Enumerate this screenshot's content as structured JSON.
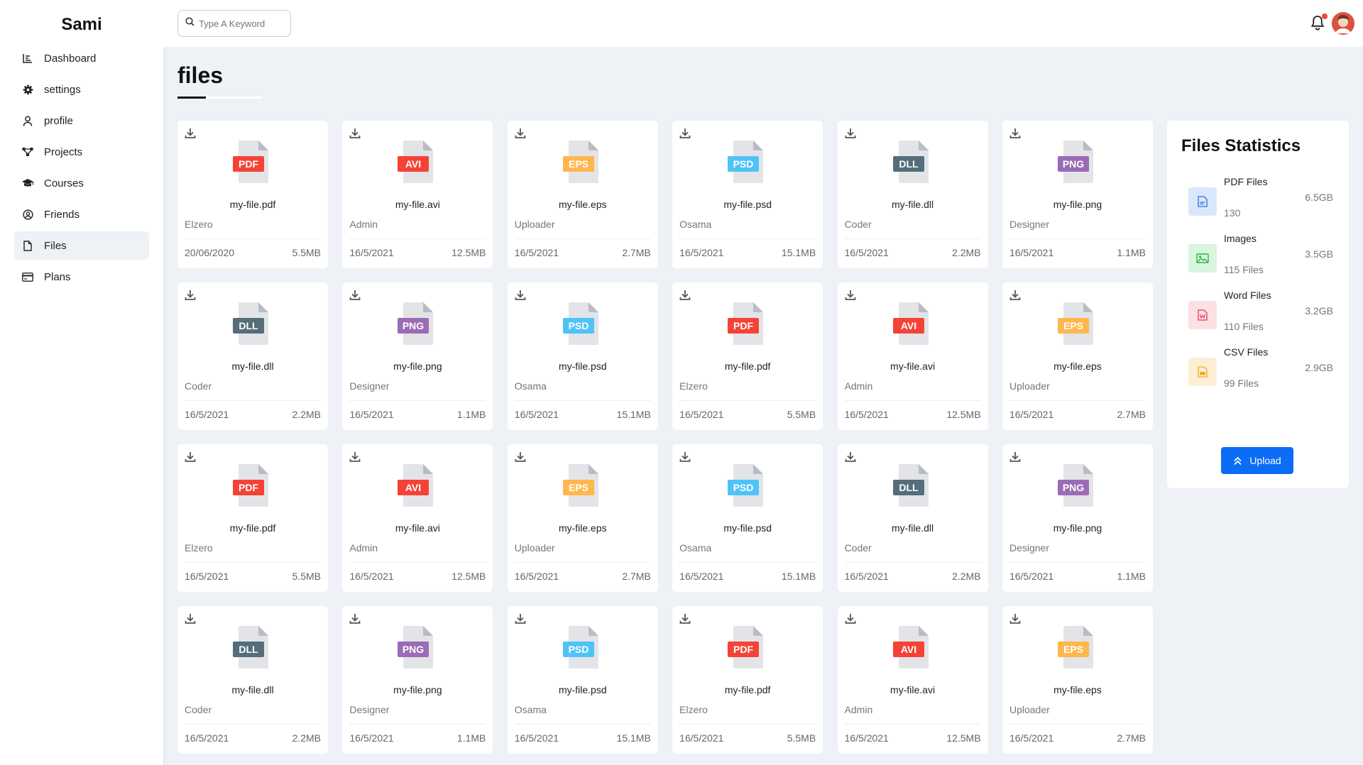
{
  "app": {
    "brand": "Sami"
  },
  "sidebar": {
    "items": [
      {
        "label": "Dashboard",
        "icon": "chart-icon"
      },
      {
        "label": "settings",
        "icon": "gear-icon"
      },
      {
        "label": "profile",
        "icon": "user-icon"
      },
      {
        "label": "Projects",
        "icon": "diagram-icon"
      },
      {
        "label": "Courses",
        "icon": "graduation-cap-icon"
      },
      {
        "label": "Friends",
        "icon": "user-circle-icon"
      },
      {
        "label": "Files",
        "icon": "file-icon",
        "active": true
      },
      {
        "label": "Plans",
        "icon": "credit-card-icon"
      }
    ]
  },
  "header": {
    "search_placeholder": "Type A Keyword"
  },
  "page": {
    "title": "files"
  },
  "type_colors": {
    "PDF": "#f44336",
    "AVI": "#f44336",
    "EPS": "#ffb74d",
    "PSD": "#4fc3f7",
    "DLL": "#546e7a",
    "PNG": "#9c6bb7"
  },
  "files": [
    {
      "type": "PDF",
      "name": "my-file.pdf",
      "owner": "Elzero",
      "date": "20/06/2020",
      "size": "5.5MB"
    },
    {
      "type": "AVI",
      "name": "my-file.avi",
      "owner": "Admin",
      "date": "16/5/2021",
      "size": "12.5MB"
    },
    {
      "type": "EPS",
      "name": "my-file.eps",
      "owner": "Uploader",
      "date": "16/5/2021",
      "size": "2.7MB"
    },
    {
      "type": "PSD",
      "name": "my-file.psd",
      "owner": "Osama",
      "date": "16/5/2021",
      "size": "15.1MB"
    },
    {
      "type": "DLL",
      "name": "my-file.dll",
      "owner": "Coder",
      "date": "16/5/2021",
      "size": "2.2MB"
    },
    {
      "type": "PNG",
      "name": "my-file.png",
      "owner": "Designer",
      "date": "16/5/2021",
      "size": "1.1MB"
    },
    {
      "type": "DLL",
      "name": "my-file.dll",
      "owner": "Coder",
      "date": "16/5/2021",
      "size": "2.2MB"
    },
    {
      "type": "PNG",
      "name": "my-file.png",
      "owner": "Designer",
      "date": "16/5/2021",
      "size": "1.1MB"
    },
    {
      "type": "PSD",
      "name": "my-file.psd",
      "owner": "Osama",
      "date": "16/5/2021",
      "size": "15.1MB"
    },
    {
      "type": "PDF",
      "name": "my-file.pdf",
      "owner": "Elzero",
      "date": "16/5/2021",
      "size": "5.5MB"
    },
    {
      "type": "AVI",
      "name": "my-file.avi",
      "owner": "Admin",
      "date": "16/5/2021",
      "size": "12.5MB"
    },
    {
      "type": "EPS",
      "name": "my-file.eps",
      "owner": "Uploader",
      "date": "16/5/2021",
      "size": "2.7MB"
    },
    {
      "type": "PDF",
      "name": "my-file.pdf",
      "owner": "Elzero",
      "date": "16/5/2021",
      "size": "5.5MB"
    },
    {
      "type": "AVI",
      "name": "my-file.avi",
      "owner": "Admin",
      "date": "16/5/2021",
      "size": "12.5MB"
    },
    {
      "type": "EPS",
      "name": "my-file.eps",
      "owner": "Uploader",
      "date": "16/5/2021",
      "size": "2.7MB"
    },
    {
      "type": "PSD",
      "name": "my-file.psd",
      "owner": "Osama",
      "date": "16/5/2021",
      "size": "15.1MB"
    },
    {
      "type": "DLL",
      "name": "my-file.dll",
      "owner": "Coder",
      "date": "16/5/2021",
      "size": "2.2MB"
    },
    {
      "type": "PNG",
      "name": "my-file.png",
      "owner": "Designer",
      "date": "16/5/2021",
      "size": "1.1MB"
    },
    {
      "type": "DLL",
      "name": "my-file.dll",
      "owner": "Coder",
      "date": "16/5/2021",
      "size": "2.2MB"
    },
    {
      "type": "PNG",
      "name": "my-file.png",
      "owner": "Designer",
      "date": "16/5/2021",
      "size": "1.1MB"
    },
    {
      "type": "PSD",
      "name": "my-file.psd",
      "owner": "Osama",
      "date": "16/5/2021",
      "size": "15.1MB"
    },
    {
      "type": "PDF",
      "name": "my-file.pdf",
      "owner": "Elzero",
      "date": "16/5/2021",
      "size": "5.5MB"
    },
    {
      "type": "AVI",
      "name": "my-file.avi",
      "owner": "Admin",
      "date": "16/5/2021",
      "size": "12.5MB"
    },
    {
      "type": "EPS",
      "name": "my-file.eps",
      "owner": "Uploader",
      "date": "16/5/2021",
      "size": "2.7MB"
    }
  ],
  "stats": {
    "title": "Files Statistics",
    "items": [
      {
        "label": "PDF Files",
        "count": "130",
        "size": "6.5GB",
        "icon": "pdf-icon",
        "bg": "#dbe8fb",
        "color": "#2b6de3"
      },
      {
        "label": "Images",
        "count": "115 Files",
        "size": "3.5GB",
        "icon": "image-icon",
        "bg": "#d8f5dd",
        "color": "#2bb34a"
      },
      {
        "label": "Word Files",
        "count": "110 Files",
        "size": "3.2GB",
        "icon": "word-icon",
        "bg": "#fbe0e4",
        "color": "#e23b55"
      },
      {
        "label": "CSV Files",
        "count": "99 Files",
        "size": "2.9GB",
        "icon": "csv-icon",
        "bg": "#fdefd4",
        "color": "#f5a623"
      }
    ],
    "upload_label": "Upload"
  }
}
